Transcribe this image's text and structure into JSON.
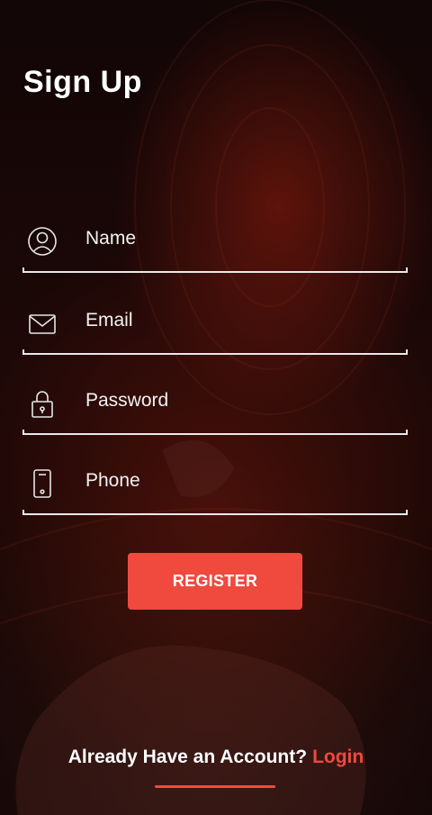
{
  "page": {
    "title": "Sign Up"
  },
  "form": {
    "fields": [
      {
        "key": "name",
        "placeholder": "Name",
        "value": "",
        "icon": "user-circle-icon"
      },
      {
        "key": "email",
        "placeholder": "Email",
        "value": "",
        "icon": "envelope-icon"
      },
      {
        "key": "password",
        "placeholder": "Password",
        "value": "",
        "icon": "lock-icon"
      },
      {
        "key": "phone",
        "placeholder": "Phone",
        "value": "",
        "icon": "phone-icon"
      }
    ],
    "register_label": "REGISTER"
  },
  "footer": {
    "question": "Already Have an Account?",
    "login_label": "Login"
  },
  "colors": {
    "accent": "#ef4a3d",
    "text": "#ffffff",
    "background": "#170705"
  }
}
